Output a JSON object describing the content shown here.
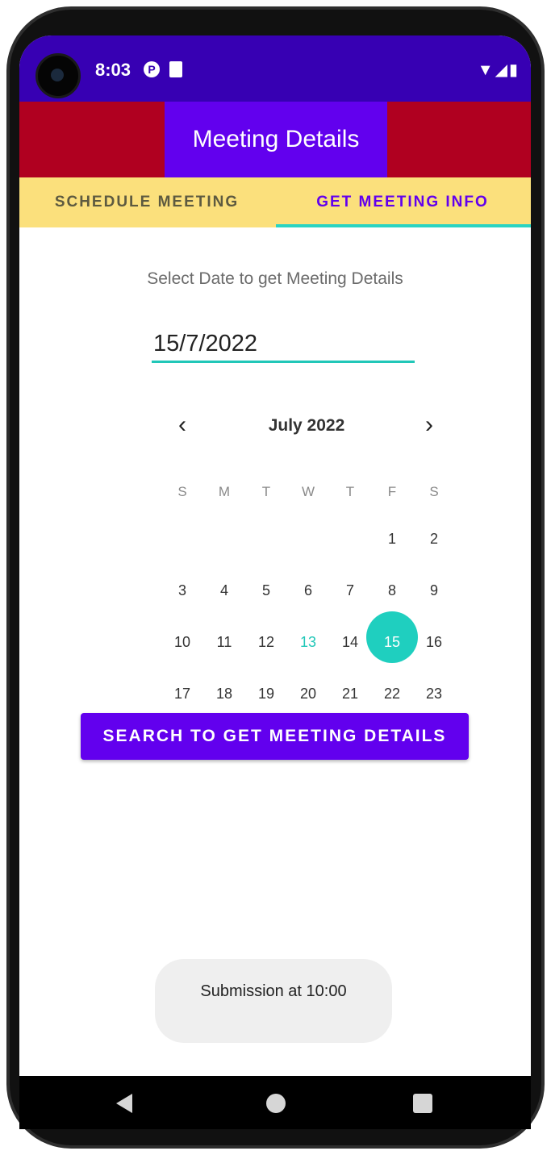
{
  "status_bar": {
    "time": "8:03",
    "icons": [
      "p-icon",
      "sd-card-icon",
      "wifi-icon",
      "signal-icon",
      "battery-icon"
    ]
  },
  "app_bar": {
    "title": "Meeting Details"
  },
  "tabs": [
    {
      "label": "SCHEDULE MEETING",
      "selected": false
    },
    {
      "label": "GET MEETING INFO",
      "selected": true
    }
  ],
  "main": {
    "hint": "Select Date to get Meeting Details",
    "date_value": "15/7/2022"
  },
  "calendar": {
    "month_title": "July 2022",
    "weekdays": [
      "S",
      "M",
      "T",
      "W",
      "T",
      "F",
      "S"
    ],
    "weeks": [
      [
        "",
        "",
        "",
        "",
        "",
        "1",
        "2"
      ],
      [
        "3",
        "4",
        "5",
        "6",
        "7",
        "8",
        "9"
      ],
      [
        "10",
        "11",
        "12",
        "13",
        "14",
        "15",
        "16"
      ],
      [
        "17",
        "18",
        "19",
        "20",
        "21",
        "22",
        "23"
      ]
    ],
    "today": "13",
    "selected": "15"
  },
  "search_button": {
    "label": "SEARCH TO GET MEETING DETAILS"
  },
  "toast": {
    "text": "Submission  at 10:00"
  },
  "colors": {
    "status_bar": "#3700b3",
    "app_bar_side": "#b00020",
    "app_bar_title_bg": "#6200ee",
    "tabs_bg": "#fbe07c",
    "accent": "#1fcfbf",
    "button": "#6200ee"
  }
}
